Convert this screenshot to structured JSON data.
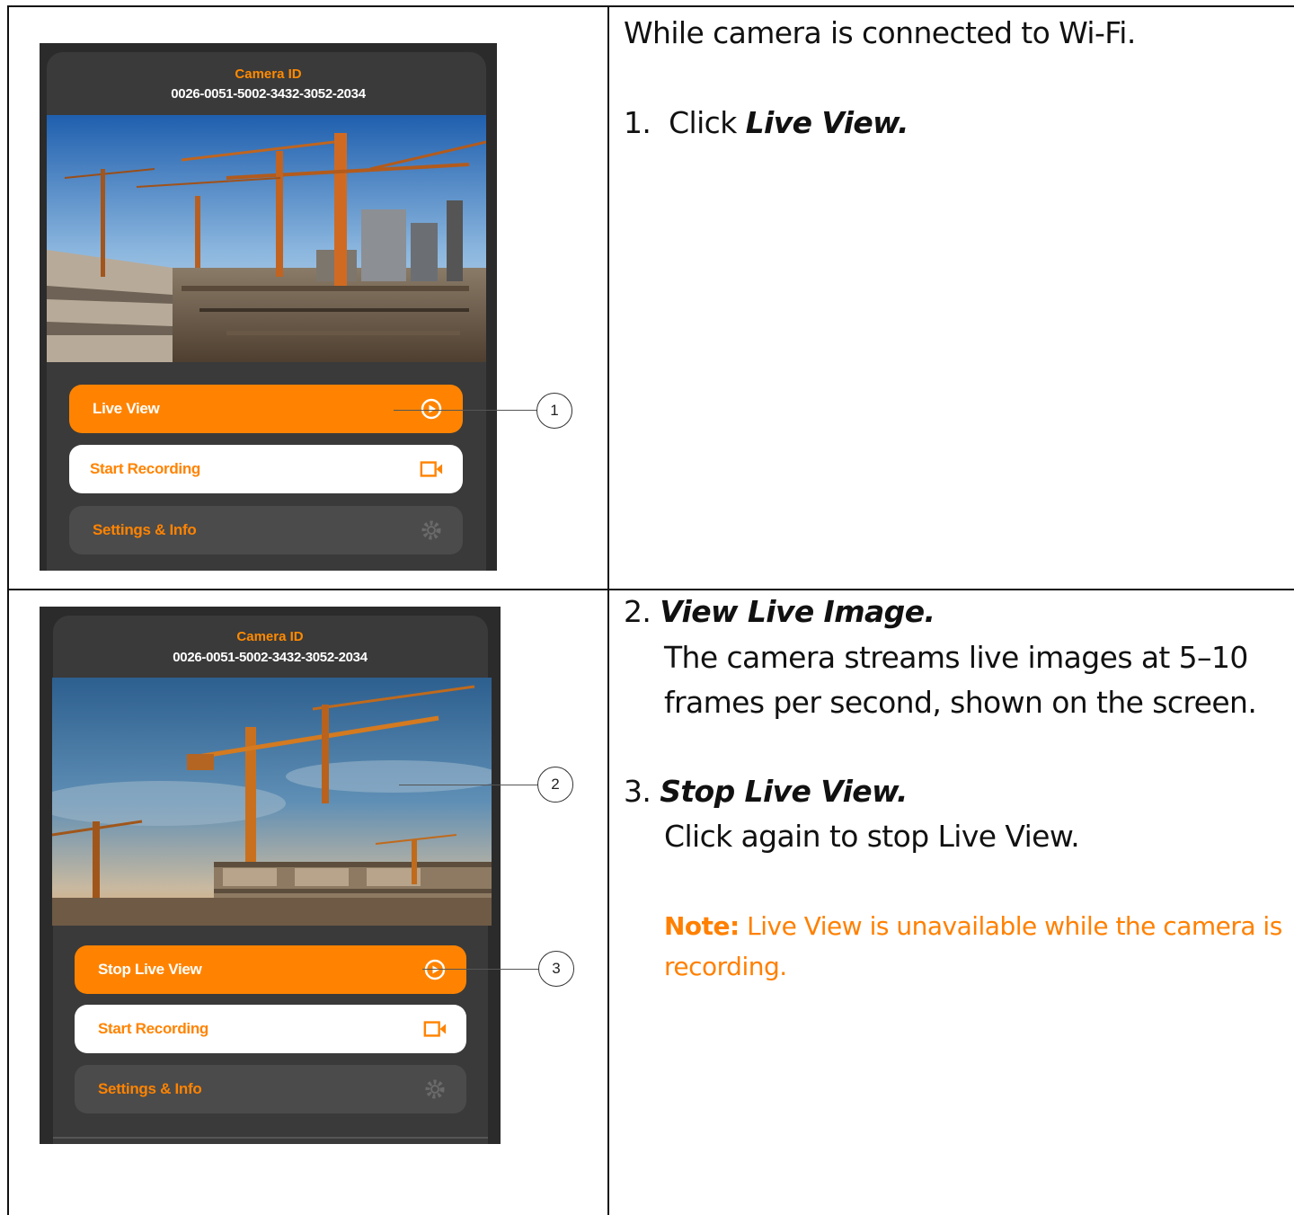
{
  "row1": {
    "intro": "While camera is connected to Wi-Fi.",
    "step1_number": "1.",
    "step1_prefix": "Click",
    "step1_action": "Live View.",
    "app": {
      "camera_id_label": "Camera ID",
      "camera_id": "0026-0051-5002-3432-3052-2034",
      "live_view_button": "Live View",
      "start_recording_button": "Start Recording",
      "settings_button": "Settings & Info"
    },
    "callout": "1"
  },
  "row2": {
    "step2_number": "2.",
    "step2_title": "View Live Image.",
    "step2_line1": "The camera streams live images at 5–10",
    "step2_line2": "frames per second, shown on the screen.",
    "step3_number": "3.",
    "step3_title": "Stop Live View.",
    "step3_text": "Click again to stop Live View.",
    "note_label": "Note:",
    "note_line1": "Live View is unavailable while the camera is",
    "note_line2": "recording.",
    "app": {
      "camera_id_label": "Camera ID",
      "camera_id": "0026-0051-5002-3432-3052-2034",
      "stop_live_view_button": "Stop Live View",
      "start_recording_button": "Start Recording",
      "settings_button": "Settings & Info"
    },
    "callout_image": "2",
    "callout_button": "3"
  },
  "colors": {
    "accent": "#ff8300",
    "phone_bg": "#2b2b2b",
    "note": "#ff8000"
  },
  "icons": [
    "play-circle-icon",
    "video-camera-icon",
    "gear-icon"
  ]
}
